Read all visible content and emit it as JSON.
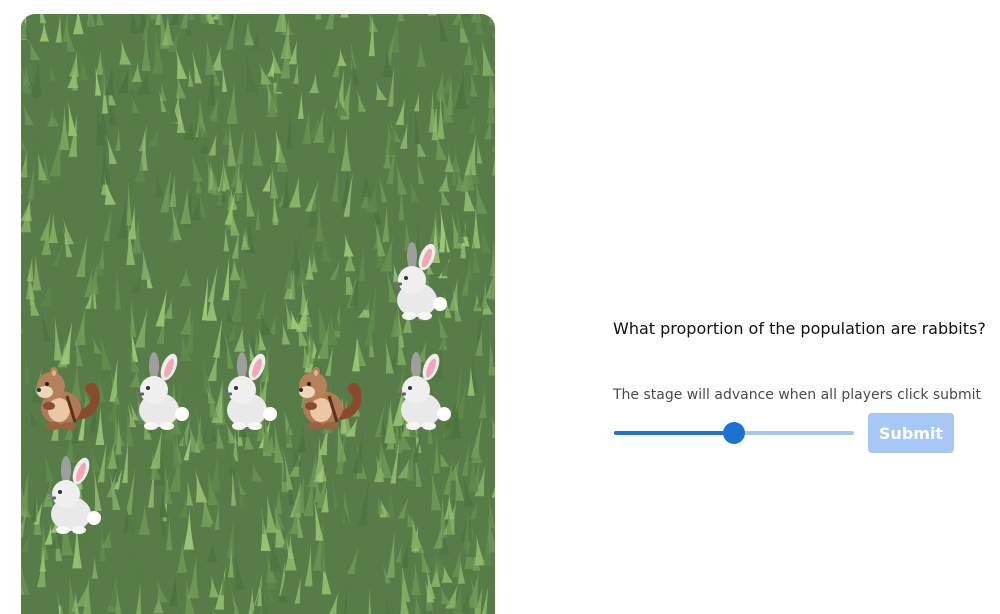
{
  "field": {
    "background": "grass",
    "animals": [
      {
        "species": "rabbit"
      },
      {
        "species": "chipmunk"
      },
      {
        "species": "rabbit"
      },
      {
        "species": "rabbit"
      },
      {
        "species": "chipmunk"
      },
      {
        "species": "rabbit"
      },
      {
        "species": "rabbit"
      }
    ]
  },
  "question": "What proportion of the population are rabbits?",
  "advance_note": "The stage will advance when all players click submit",
  "slider": {
    "value": 0.5,
    "min": 0,
    "max": 1
  },
  "submit_label": "Submit",
  "colors": {
    "grass": "#577c47",
    "slider_active": "#1a73d1",
    "slider_track": "#a9c7ea",
    "submit_disabled": "#a7c8f6"
  }
}
